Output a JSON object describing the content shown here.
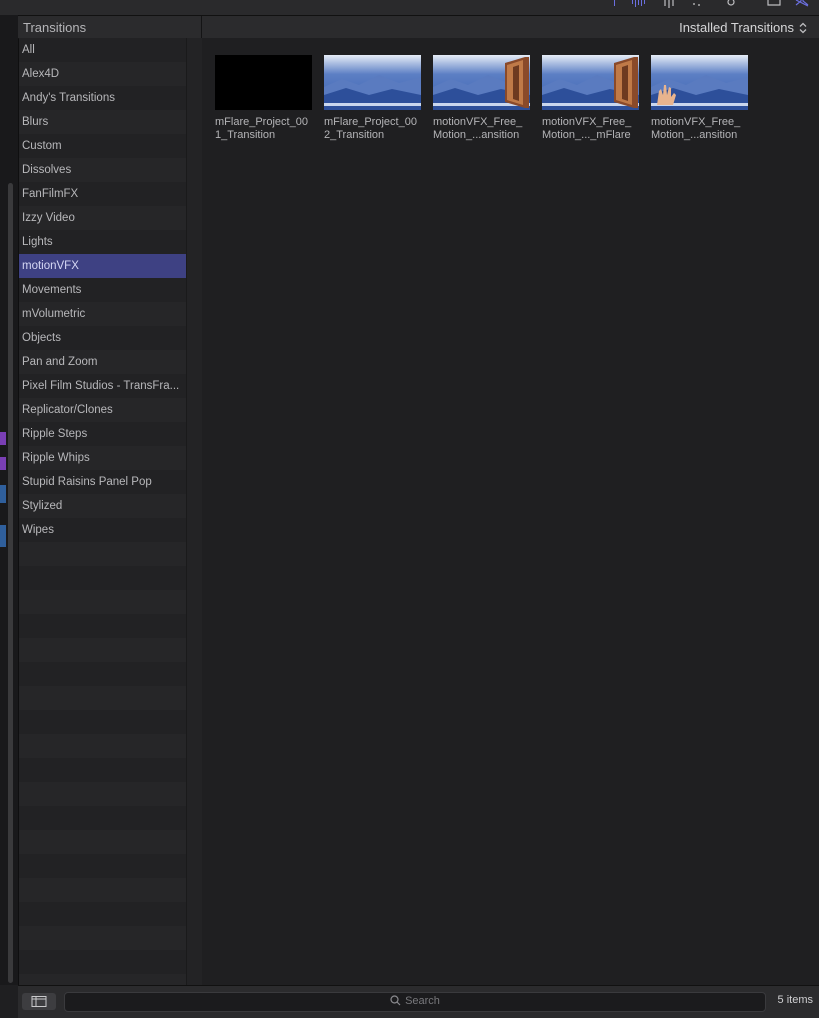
{
  "header": {
    "left_title": "Transitions",
    "right_title": "Installed Transitions"
  },
  "sidebar": {
    "items": [
      {
        "label": "All"
      },
      {
        "label": "Alex4D"
      },
      {
        "label": "Andy's Transitions"
      },
      {
        "label": "Blurs"
      },
      {
        "label": "Custom"
      },
      {
        "label": "Dissolves"
      },
      {
        "label": "FanFilmFX"
      },
      {
        "label": "Izzy Video"
      },
      {
        "label": "Lights"
      },
      {
        "label": "motionVFX",
        "selected": true
      },
      {
        "label": "Movements"
      },
      {
        "label": "mVolumetric"
      },
      {
        "label": "Objects"
      },
      {
        "label": "Pan and Zoom"
      },
      {
        "label": "Pixel Film Studios - TransFra..."
      },
      {
        "label": "Replicator/Clones"
      },
      {
        "label": "Ripple Steps"
      },
      {
        "label": "Ripple Whips"
      },
      {
        "label": "Stupid Raisins Panel Pop"
      },
      {
        "label": "Stylized"
      },
      {
        "label": "Wipes"
      }
    ]
  },
  "browser": {
    "items": [
      {
        "label": "mFlare_Project_00\n1_Transition",
        "thumb": "black"
      },
      {
        "label": "mFlare_Project_00\n2_Transition",
        "thumb": "mountains"
      },
      {
        "label": "motionVFX_Free_\nMotion_...ansition",
        "thumb": "mountains-door"
      },
      {
        "label": "motionVFX_Free_\nMotion_..._mFlare",
        "thumb": "mountains-door"
      },
      {
        "label": "motionVFX_Free_\nMotion_...ansition",
        "thumb": "mountains-hand"
      }
    ]
  },
  "footer": {
    "search_placeholder": "Search",
    "item_count": "5 items"
  },
  "colors": {
    "selection": "#3e4183",
    "background": "#1f1f21",
    "sky": "#5c7fc4",
    "mountain": "#2d4f9a"
  }
}
